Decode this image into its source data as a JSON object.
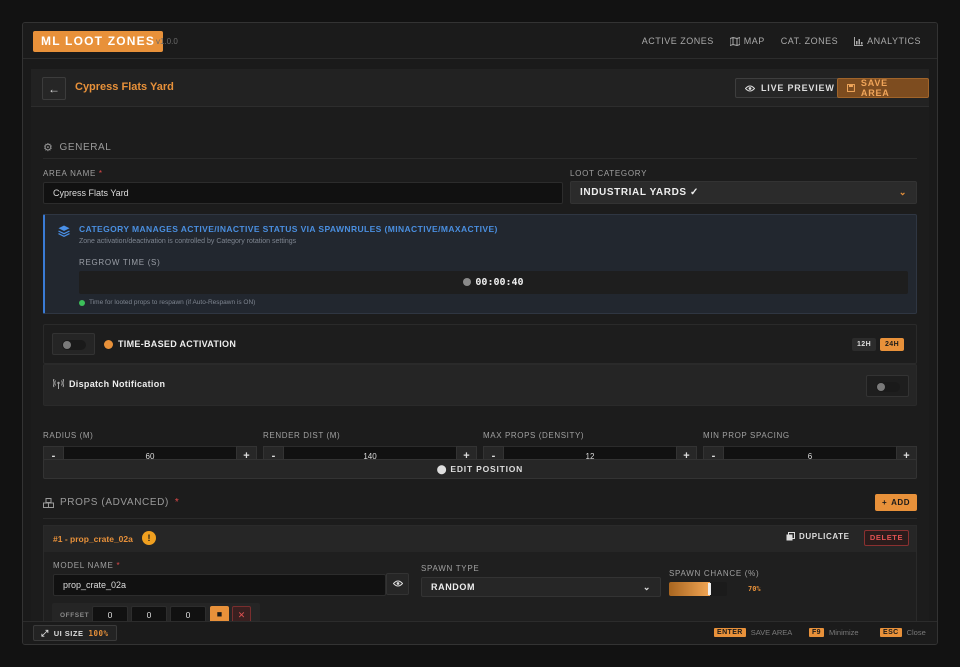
{
  "app": {
    "title": "ML LOOT ZONES",
    "version": "v1.0.0",
    "nav": [
      {
        "label": "ACTIVE ZONES",
        "icon": ""
      },
      {
        "label": "MAP",
        "icon": "map-icon"
      },
      {
        "label": "CAT. ZONES",
        "icon": ""
      },
      {
        "label": "ANALYTICS",
        "icon": "chart-icon"
      }
    ]
  },
  "header": {
    "title": "Cypress Flats Yard",
    "live_preview": "LIVE PREVIEW",
    "save_area": "SAVE AREA"
  },
  "general": {
    "section_title": "GENERAL",
    "area_name_label": "AREA NAME",
    "area_name_value": "Cypress Flats Yard",
    "loot_category_label": "LOOT CATEGORY",
    "loot_category_value": "INDUSTRIAL YARDS ✓"
  },
  "info": {
    "title": "CATEGORY MANAGES ACTIVE/INACTIVE STATUS VIA SPAWNRULES (MINACTIVE/MAXACTIVE)",
    "subtitle": "Zone activation/deactivation is controlled by Category rotation settings",
    "regrow_label": "REGROW TIME (S)",
    "regrow_value": "00:00:40",
    "regrow_hint": "Time for looted props to respawn (if Auto-Respawn is ON)"
  },
  "time_activation": {
    "label": "TIME-BASED ACTIVATION",
    "enabled": false,
    "formats": [
      "12H",
      "24H"
    ],
    "selected_format": "24H"
  },
  "dispatch": {
    "label": "Dispatch Notification",
    "enabled": false
  },
  "numbers": [
    {
      "label": "RADIUS (M)",
      "value": "60"
    },
    {
      "label": "RENDER DIST (M)",
      "value": "140"
    },
    {
      "label": "MAX PROPS (DENSITY)",
      "value": "12"
    },
    {
      "label": "MIN PROP SPACING",
      "value": "6"
    }
  ],
  "edit_position": "EDIT POSITION",
  "props": {
    "section_title": "PROPS (ADVANCED)",
    "add_label": "ADD",
    "items": [
      {
        "title": "#1 - prop_crate_02a",
        "warning": "!",
        "duplicate": "DUPLICATE",
        "delete": "DELETE",
        "model_name_label": "MODEL NAME",
        "model_name_value": "prop_crate_02a",
        "spawn_type_label": "SPAWN TYPE",
        "spawn_type_value": "RANDOM",
        "spawn_chance_label": "SPAWN CHANCE (%)",
        "spawn_chance_value": 70,
        "spawn_chance_text": "70%",
        "offset_label": "OFFSET",
        "offset": [
          "0",
          "0",
          "0"
        ]
      }
    ]
  },
  "footer": {
    "ui_size_label": "UI SIZE",
    "ui_size_value": "100%",
    "shortcuts": [
      {
        "key": "ENTER",
        "label": "SAVE AREA"
      },
      {
        "key": "F9",
        "label": "Minimize"
      },
      {
        "key": "ESC",
        "label": "Close"
      }
    ]
  },
  "colors": {
    "accent": "#e8913a",
    "info_blue": "#4a8fe0",
    "danger": "#e05252",
    "success": "#3cbf5a"
  }
}
